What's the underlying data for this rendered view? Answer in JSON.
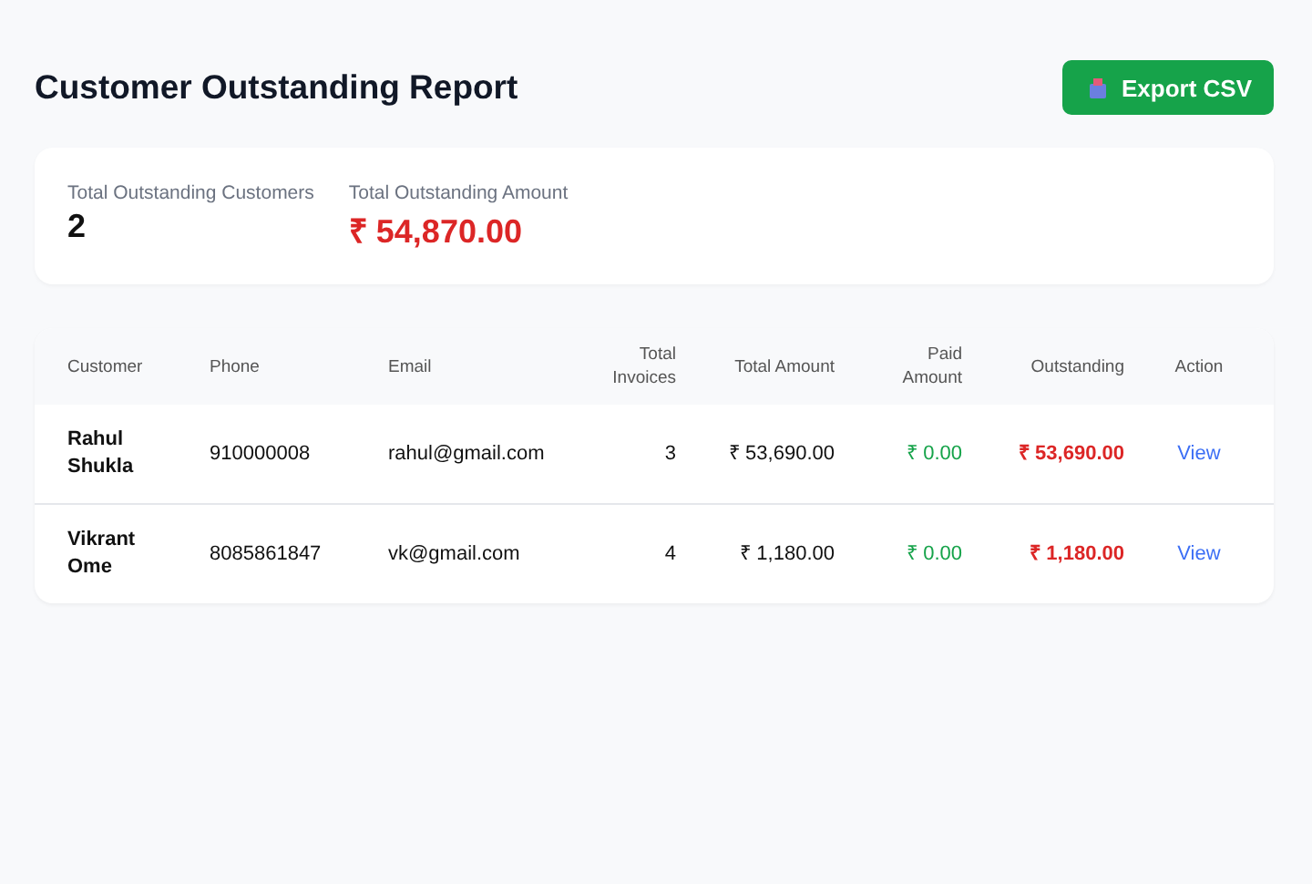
{
  "header": {
    "title": "Customer Outstanding Report",
    "export_button": {
      "label": "Export CSV"
    }
  },
  "summary": [
    {
      "label": "Total Outstanding Customers",
      "value": "2",
      "kind": "count"
    },
    {
      "label": "Total Outstanding Amount",
      "value": "₹ 54,870.00",
      "kind": "amount"
    }
  ],
  "table": {
    "columns": [
      "Customer",
      "Phone",
      "Email",
      "Total Invoices",
      "Total Amount",
      "Paid Amount",
      "Outstanding",
      "Action"
    ],
    "rows": [
      {
        "customer": "Rahul Shukla",
        "phone": "910000008",
        "email": "rahul@gmail.com",
        "total_invoices": "3",
        "total_amount": "₹ 53,690.00",
        "paid_amount": "₹ 0.00",
        "outstanding": "₹ 53,690.00",
        "action": "View"
      },
      {
        "customer": "Vikrant Ome",
        "phone": "8085861847",
        "email": "vk@gmail.com",
        "total_invoices": "4",
        "total_amount": "₹ 1,180.00",
        "paid_amount": "₹ 0.00",
        "outstanding": "₹ 1,180.00",
        "action": "View"
      }
    ]
  }
}
